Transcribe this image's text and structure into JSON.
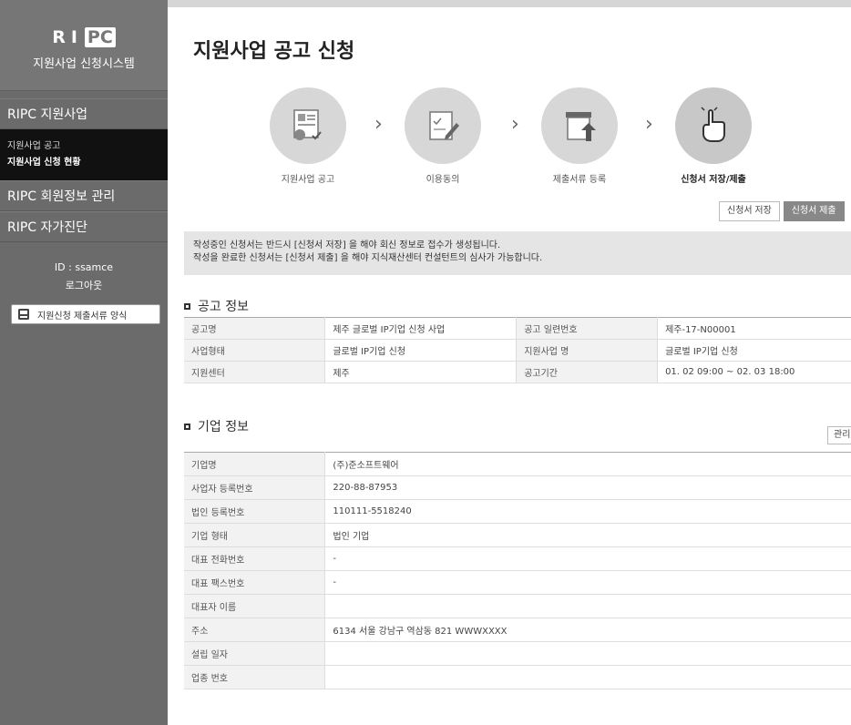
{
  "sidebar": {
    "brand_logo_left": "RI",
    "brand_logo_box": "PC",
    "brand_subtitle": "지원사업 신청시스템",
    "menu1": "RIPC 지원사업",
    "sub_items": [
      "지원사업 공고",
      "지원사업 신청 현황"
    ],
    "menu2": "RIPC 회원정보 관리",
    "menu3": "RIPC 자가진단",
    "user_id": "ID : ssamce",
    "logout": "로그아웃",
    "form_link": "지원신청 제출서류 양식"
  },
  "page": {
    "title": "지원사업 공고 신청"
  },
  "steps": [
    {
      "label": "지원사업 공고",
      "icon": "announcement-icon"
    },
    {
      "label": "이용동의",
      "icon": "agreement-icon"
    },
    {
      "label": "제출서류 등록",
      "icon": "upload-icon"
    },
    {
      "label": "신청서 저장/제출",
      "icon": "hand-click-icon"
    }
  ],
  "buttons": {
    "save": "신청서 저장",
    "submit": "신청서 제출"
  },
  "notice": {
    "line1": "작성중인 신청서는 반드시 [신청서 저장] 을 해야 회신 정보로 접수가 생성됩니다.",
    "line2": "작성을 완료한 신청서는 [신청서 제출] 을 해야 지식재산센터 컨설턴트의 심사가 가능합니다."
  },
  "notice_section": {
    "title": "공고 정보",
    "rows": [
      [
        "공고명",
        "제주 글로벌 IP기업 신청 사업",
        "공고 일련번호",
        "제주-17-N00001"
      ],
      [
        "사업형태",
        "글로벌 IP기업 신청",
        "지원사업 명",
        "글로벌 IP기업 신청"
      ],
      [
        "지원센터",
        "제주",
        "공고기간",
        "01. 02 09:00 ~ 02. 03 18:00"
      ]
    ]
  },
  "company_section": {
    "title": "기업 정보",
    "manage_button": "관리",
    "rows": [
      [
        "기업명",
        "(주)준소프트웨어"
      ],
      [
        "사업자 등록번호",
        "220-88-87953"
      ],
      [
        "법인 등록번호",
        "110111-5518240"
      ],
      [
        "기업 형태",
        "법인 기업"
      ],
      [
        "대표 전화번호",
        "-"
      ],
      [
        "대표 팩스번호",
        "-"
      ],
      [
        "대표자 이름",
        ""
      ],
      [
        "주소",
        "6134 서울 강남구 역삼동 821 WWWXXXX"
      ],
      [
        "설립 일자",
        ""
      ],
      [
        "업종 번호",
        ""
      ]
    ]
  },
  "colors": {
    "sidebar_bg": "#6b6b6b",
    "submenu_bg": "#111111",
    "step_circle": "#d7d7d7",
    "notice_bg": "#e5e5e5"
  }
}
